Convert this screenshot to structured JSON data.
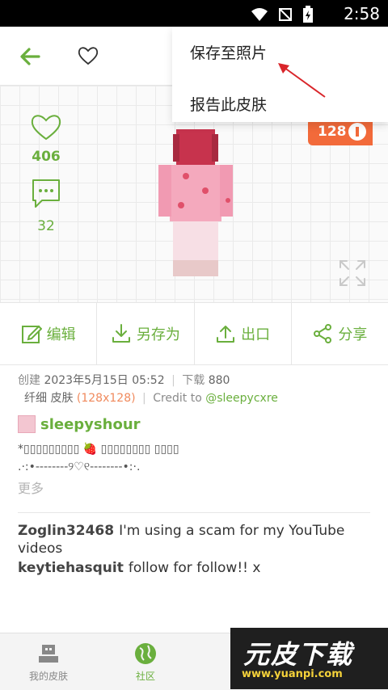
{
  "status_bar": {
    "time": "2:58"
  },
  "menu": {
    "save_to_photos": "保存至照片",
    "report_skin": "报告此皮肤"
  },
  "preview": {
    "likes": "406",
    "comments": "32",
    "resolution_badge": "128"
  },
  "actions": {
    "edit": "编辑",
    "save_as": "另存为",
    "export": "出口",
    "share": "分享"
  },
  "meta": {
    "created_label": "创建",
    "created_value": "2023年5月15日 05:52",
    "downloads_label": "下载",
    "downloads_value": "880",
    "type_label": "纤细 皮肤",
    "resolution": "(128x128)",
    "credit_label": "Credit to",
    "credit_user": "@sleepycxre"
  },
  "author": {
    "name": "sleepyshour"
  },
  "description": {
    "line1": "*▯▯▯▯▯▯▯▯▯ 🍓 ▯▯▯▯▯▯▯▯ ▯▯▯▯",
    "line2": ".·:•--------୨♡୧--------•:·.",
    "more": "更多"
  },
  "comments": [
    {
      "user": "Zoglin32468",
      "text": "I'm using a scam for my YouTube videos"
    },
    {
      "user": "keytiehasquit",
      "text": "follow for follow!! x"
    }
  ],
  "bottom_nav": {
    "my_skins": "我的皮肤",
    "community": "社区"
  },
  "watermark": {
    "brand": "元皮下载",
    "url": "www.yuanpi.com"
  },
  "colors": {
    "accent": "#6aaf3d",
    "badge": "#f26a3a",
    "arrow": "#d9252a"
  }
}
